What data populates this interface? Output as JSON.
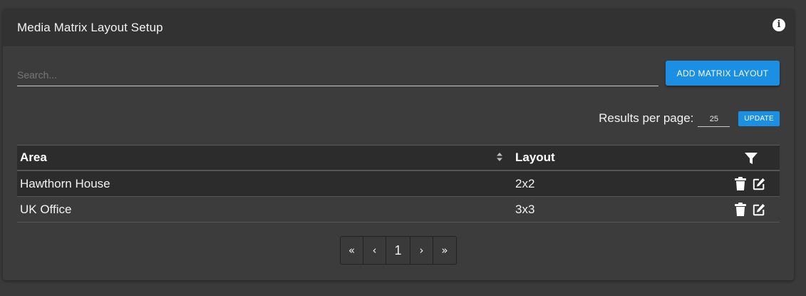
{
  "header": {
    "title": "Media Matrix Layout Setup",
    "info_icon": "i"
  },
  "search": {
    "placeholder": "Search...",
    "value": ""
  },
  "toolbar": {
    "add_label": "ADD MATRIX LAYOUT"
  },
  "paging_controls": {
    "results_label": "Results per page:",
    "results_value": "25",
    "update_label": "UPDATE"
  },
  "table": {
    "columns": [
      "Area",
      "Layout"
    ],
    "rows": [
      {
        "area": "Hawthorn House",
        "layout": "2x2"
      },
      {
        "area": "UK Office",
        "layout": "3x3"
      }
    ]
  },
  "pagination": {
    "first": "«",
    "prev": "‹",
    "current": "1",
    "next": "›",
    "last": "»"
  },
  "colors": {
    "accent": "#1a8fe3",
    "background": "#3a3a3a",
    "header_bg": "#323232"
  }
}
